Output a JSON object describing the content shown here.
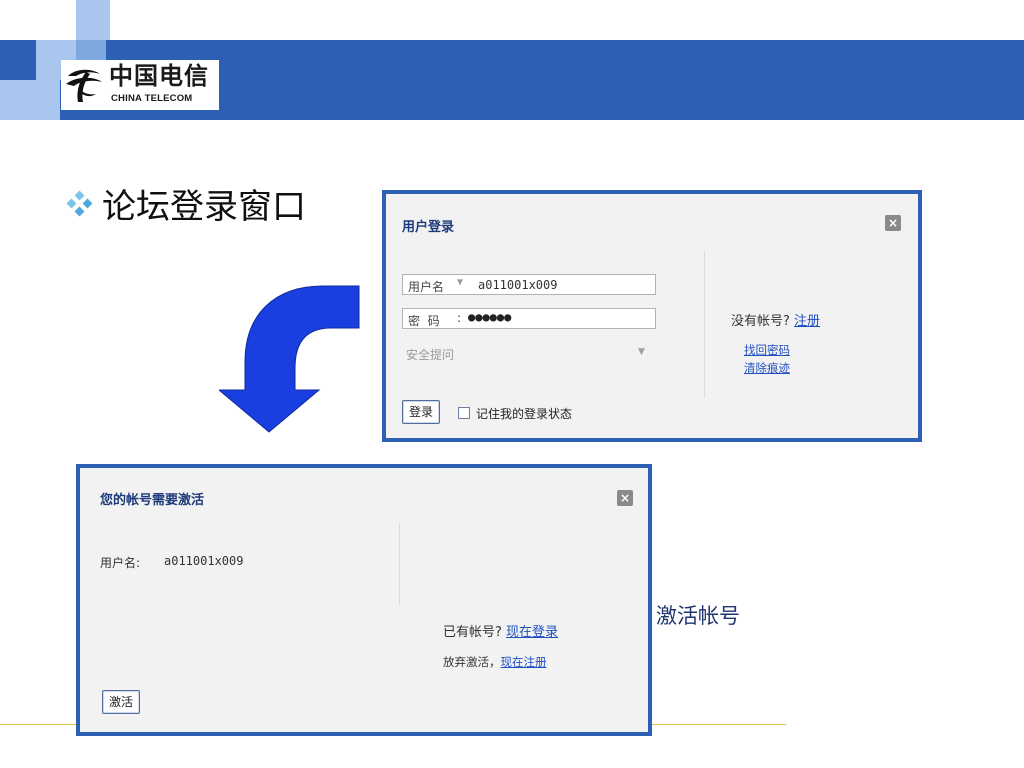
{
  "header": {
    "brand_cn": "中国电信",
    "brand_en": "CHINA TELECOM",
    "band_color": "#2d5fb4",
    "accent_light": "#a9c6ef",
    "accent_mid": "#7fa8e0"
  },
  "slide": {
    "title": "论坛登录窗口",
    "caption": "激活帐号"
  },
  "login_dialog": {
    "title": "用户登录",
    "close_glyph": "×",
    "username": {
      "label": "用户名",
      "caret": "▼",
      "value": "a011001x009"
    },
    "password": {
      "label": "密  码",
      "colon": ":",
      "value": "●●●●●●"
    },
    "security_question": {
      "placeholder": "安全提问",
      "caret": "▼"
    },
    "no_account_text": "没有帐号?",
    "register_link": "注册",
    "forgot_password_link": "找回密码",
    "clear_traces_link": "清除痕迹",
    "login_button": "登录",
    "remember_me_label": "记住我的登录状态",
    "remember_me_checked": false
  },
  "activate_dialog": {
    "title": "您的帐号需要激活",
    "close_glyph": "×",
    "username_label": "用户名:",
    "username_value": "a011001x009",
    "have_account_text": "已有帐号?",
    "login_now_link": "现在登录",
    "abandon_text": "放弃激活，",
    "register_now_link": "现在注册",
    "activate_button": "激活"
  },
  "colors": {
    "dialog_border": "#2d5fb4",
    "dialog_bg": "#f2f2f2",
    "link": "#1f4fc0",
    "arrow_fill": "#1a3fe0",
    "footer_line": "#e3c04a"
  }
}
